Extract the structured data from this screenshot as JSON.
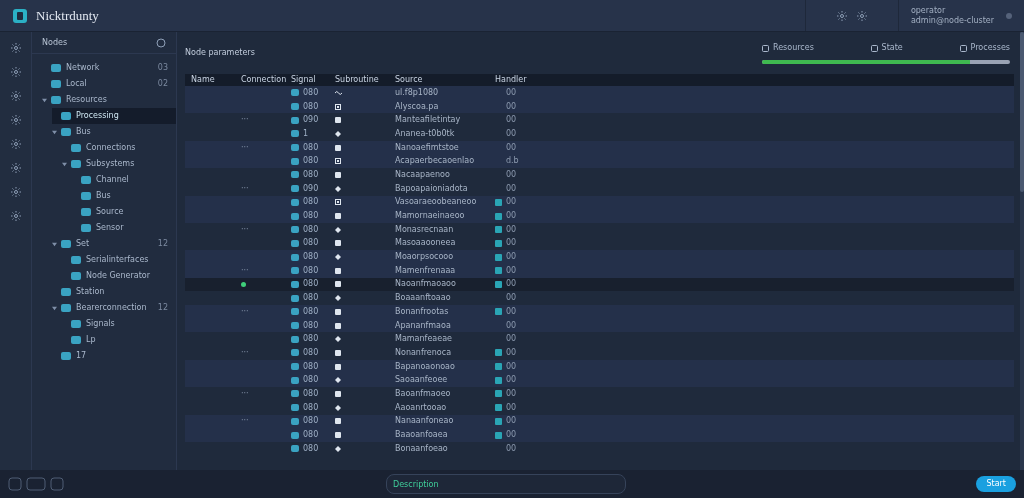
{
  "app": {
    "title": "Nicktrdunty"
  },
  "header": {
    "user_name": "operator",
    "user_detail": "admin@node-cluster"
  },
  "tree": {
    "title": "Nodes",
    "items": [
      {
        "label": "Network",
        "count": "03",
        "selected": false
      },
      {
        "label": "Local",
        "count": "02",
        "selected": false
      },
      {
        "label": "Resources",
        "expanded": true,
        "selected": false,
        "children": [
          {
            "label": "Processing",
            "selected": true
          },
          {
            "label": "Bus",
            "expanded": true,
            "selected": false,
            "children": [
              {
                "label": "Connections",
                "selected": false
              },
              {
                "label": "Subsystems",
                "expanded": true,
                "selected": false,
                "children": [
                  {
                    "label": "Channel",
                    "selected": false
                  },
                  {
                    "label": "Bus",
                    "selected": false
                  },
                  {
                    "label": "Source",
                    "selected": false
                  },
                  {
                    "label": "Sensor",
                    "selected": false
                  }
                ]
              }
            ]
          },
          {
            "label": "Set",
            "count": "12",
            "expanded": true,
            "selected": false,
            "children": [
              {
                "label": "Serialinterfaces",
                "selected": false
              },
              {
                "label": "Node Generator",
                "selected": false
              }
            ]
          },
          {
            "label": "Station",
            "selected": false
          },
          {
            "label": "Bearerconnection",
            "count": "12",
            "expanded": true,
            "selected": false,
            "children": [
              {
                "label": "Signals",
                "selected": false
              },
              {
                "label": "Lp",
                "selected": false
              }
            ]
          },
          {
            "label": "17",
            "selected": false
          }
        ]
      }
    ]
  },
  "main": {
    "title": "Node parameters",
    "stats": [
      {
        "label": "Resources"
      },
      {
        "label": "State"
      },
      {
        "label": "Processes"
      }
    ],
    "progress": {
      "level": 0.84
    },
    "columns": [
      "Name",
      "Connection",
      "Signal",
      "Subroutine",
      "Source",
      "Handler"
    ],
    "rows": [
      {
        "code": "080",
        "kind": "wave",
        "source": "ul.f8p1080",
        "value": "00",
        "badge": false,
        "selected": false
      },
      {
        "code": "080",
        "kind": "grid",
        "source": "Alyscoa.pa",
        "value": "00",
        "badge": false,
        "selected": false
      },
      {
        "mark": "···",
        "code": "090",
        "kind": "square",
        "source": "Manteafiletintay",
        "value": "00",
        "badge": false,
        "selected": false
      },
      {
        "code": "1",
        "kind": "diamond",
        "source": "Ananea-t0b0tk",
        "value": "00",
        "badge": false,
        "selected": false
      },
      {
        "mark": "···",
        "code": "080",
        "kind": "square",
        "source": "Nanoaefimtstoe",
        "value": "00",
        "badge": false,
        "selected": false
      },
      {
        "code": "080",
        "kind": "grid",
        "source": "Acapaerbecaoenlao",
        "value": "d.b",
        "badge": false,
        "selected": false
      },
      {
        "code": "080",
        "kind": "square",
        "source": "Nacaapaenoo",
        "value": "00",
        "badge": false,
        "selected": false
      },
      {
        "mark": "···",
        "code": "090",
        "kind": "diamond",
        "source": "Bapoapaioniadota",
        "value": "00",
        "badge": false,
        "selected": false
      },
      {
        "code": "080",
        "kind": "grid",
        "source": "Vasoaraeoobeaneoo",
        "value": "00",
        "badge": true,
        "selected": false
      },
      {
        "code": "080",
        "kind": "square",
        "source": "Mamornaeinaeoo",
        "value": "00",
        "badge": true,
        "selected": false
      },
      {
        "mark": "···",
        "code": "080",
        "kind": "diamond",
        "source": "Monasrecnaan",
        "value": "00",
        "badge": true,
        "selected": false
      },
      {
        "code": "080",
        "kind": "square",
        "source": "Masoaaooneea",
        "value": "00",
        "badge": true,
        "selected": false
      },
      {
        "code": "080",
        "kind": "diamond",
        "source": "Moaorpsocooo",
        "value": "00",
        "badge": true,
        "selected": false
      },
      {
        "mark": "···",
        "code": "080",
        "kind": "square",
        "source": "Mamenfrenaaa",
        "value": "00",
        "badge": true,
        "selected": false
      },
      {
        "code": "080",
        "kind": "square",
        "source": "Naoanfmaoaoo",
        "value": "00",
        "badge": true,
        "selected": true
      },
      {
        "code": "080",
        "kind": "diamond",
        "source": "Boaaanftoaao",
        "value": "00",
        "badge": false,
        "selected": false
      },
      {
        "mark": "···",
        "code": "080",
        "kind": "square",
        "source": "Bonanfrootas",
        "value": "00",
        "badge": true,
        "selected": false
      },
      {
        "code": "080",
        "kind": "square",
        "source": "Apananfmaoa",
        "value": "00",
        "badge": false,
        "selected": false
      },
      {
        "code": "080",
        "kind": "diamond",
        "source": "Mamanfeaeae",
        "value": "00",
        "badge": false,
        "selected": false
      },
      {
        "mark": "···",
        "code": "080",
        "kind": "square",
        "source": "Nonanfrenoca",
        "value": "00",
        "badge": true,
        "selected": false
      },
      {
        "code": "080",
        "kind": "square",
        "source": "Bapanoaonoao",
        "value": "00",
        "badge": true,
        "selected": false
      },
      {
        "code": "080",
        "kind": "diamond",
        "source": "Saoaanfeoee",
        "value": "00",
        "badge": true,
        "selected": false
      },
      {
        "mark": "···",
        "code": "080",
        "kind": "square",
        "source": "Baoanfmaoeo",
        "value": "00",
        "badge": true,
        "selected": false
      },
      {
        "code": "080",
        "kind": "diamond",
        "source": "Aaoanrtooao",
        "value": "00",
        "badge": true,
        "selected": false
      },
      {
        "mark": "···",
        "code": "080",
        "kind": "square",
        "source": "Nanaanfoneao",
        "value": "00",
        "badge": true,
        "selected": false
      },
      {
        "code": "080",
        "kind": "square",
        "source": "Baaoanfoaea",
        "value": "00",
        "badge": true,
        "selected": false
      },
      {
        "code": "080",
        "kind": "diamond",
        "source": "Bonaanfoeao",
        "value": "00",
        "badge": false,
        "selected": false
      }
    ]
  },
  "footer": {
    "command": {
      "value": "Description"
    },
    "button": "Start"
  }
}
